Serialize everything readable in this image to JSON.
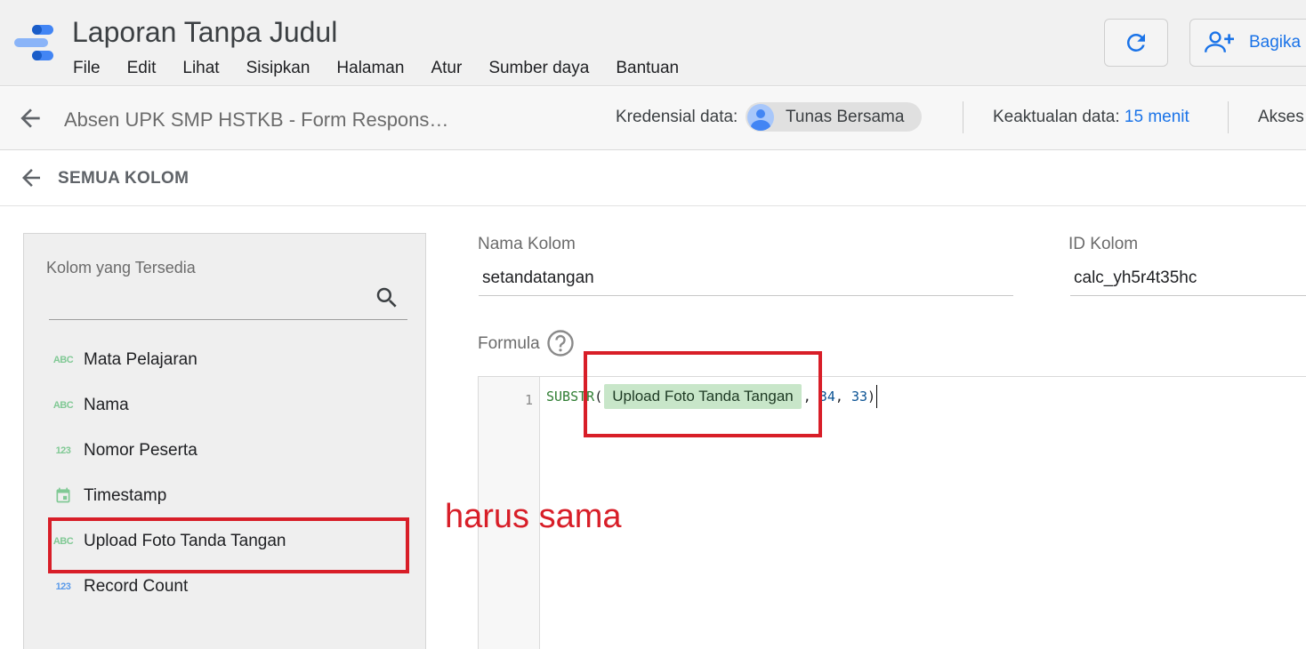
{
  "app": {
    "title": "Laporan Tanpa Judul",
    "menu": [
      "File",
      "Edit",
      "Lihat",
      "Sisipkan",
      "Halaman",
      "Atur",
      "Sumber daya",
      "Bantuan"
    ],
    "refresh_icon": "refresh-icon",
    "share_label": "Bagika"
  },
  "source_bar": {
    "name": "Absen UPK SMP HSTKB - Form Respons…",
    "credential_label": "Kredensial data:",
    "credential_owner": "Tunas Bersama",
    "freshness_label": "Keaktualan data:",
    "freshness_value": "15 menit",
    "access_label": "Akses"
  },
  "columns_header": {
    "title": "SEMUA KOLOM"
  },
  "fields_panel": {
    "title": "Kolom yang Tersedia",
    "items": [
      {
        "type_badge": "ABC",
        "type": "text",
        "label": "Mata Pelajaran"
      },
      {
        "type_badge": "ABC",
        "type": "text",
        "label": "Nama"
      },
      {
        "type_badge": "123",
        "type": "number",
        "label": "Nomor Peserta"
      },
      {
        "type_badge": "",
        "type": "date",
        "label": "Timestamp"
      },
      {
        "type_badge": "ABC",
        "type": "text",
        "label": "Upload Foto Tanda Tangan"
      },
      {
        "type_badge": "123",
        "type": "metric",
        "label": "Record Count"
      }
    ]
  },
  "form": {
    "column_name_label": "Nama Kolom",
    "column_name_value": "setandatangan",
    "column_id_label": "ID Kolom",
    "column_id_value": "calc_yh5r4t35hc",
    "formula_label": "Formula"
  },
  "formula": {
    "line_number": "1",
    "function": "SUBSTR",
    "open_paren": "(",
    "field_chip": "Upload Foto Tanda Tangan",
    "sep1": ",",
    "arg1": "34",
    "sep2": ",",
    "arg2": "33",
    "close_paren": ")"
  },
  "annotation": {
    "note": "harus sama",
    "color": "#d81e28"
  },
  "colors": {
    "accent": "#1a73e8",
    "chip_bg": "#c8e6c9",
    "text_type_icon": "#81c995",
    "metric_type_icon": "#5b9bea"
  }
}
